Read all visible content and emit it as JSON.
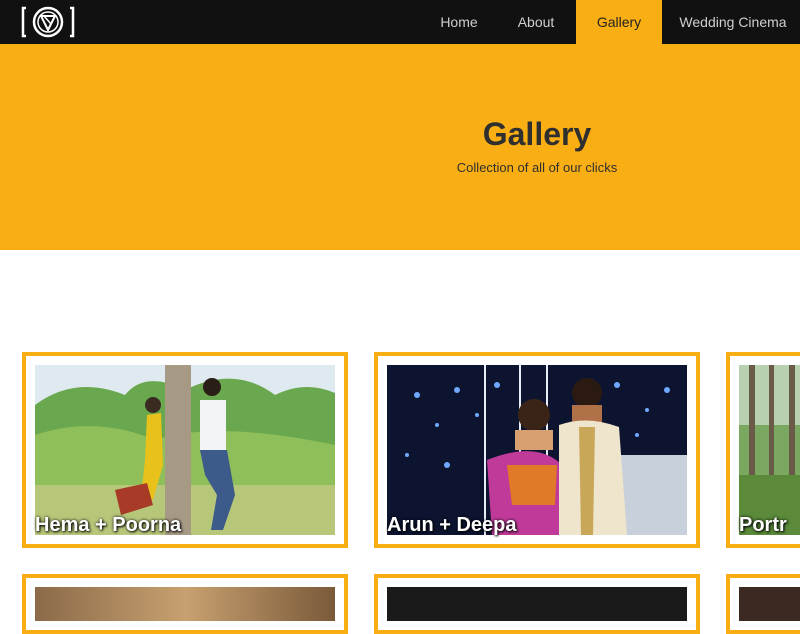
{
  "colors": {
    "accent": "#f9af13",
    "navbar_bg": "#111111",
    "text_dark": "#2f2f2f"
  },
  "navbar": {
    "logo_icon": "camera-aperture-logo-icon",
    "items": [
      {
        "label": "Home",
        "active": false
      },
      {
        "label": "About",
        "active": false
      },
      {
        "label": "Gallery",
        "active": true
      },
      {
        "label": "Wedding Cinema",
        "active": false
      }
    ]
  },
  "hero": {
    "title": "Gallery",
    "subtitle": "Collection of all of our clicks"
  },
  "gallery": {
    "items": [
      {
        "caption": "Hema + Poorna"
      },
      {
        "caption": "Arun + Deepa"
      },
      {
        "caption": "Portr"
      },
      {
        "caption": ""
      },
      {
        "caption": ""
      },
      {
        "caption": ""
      }
    ]
  }
}
